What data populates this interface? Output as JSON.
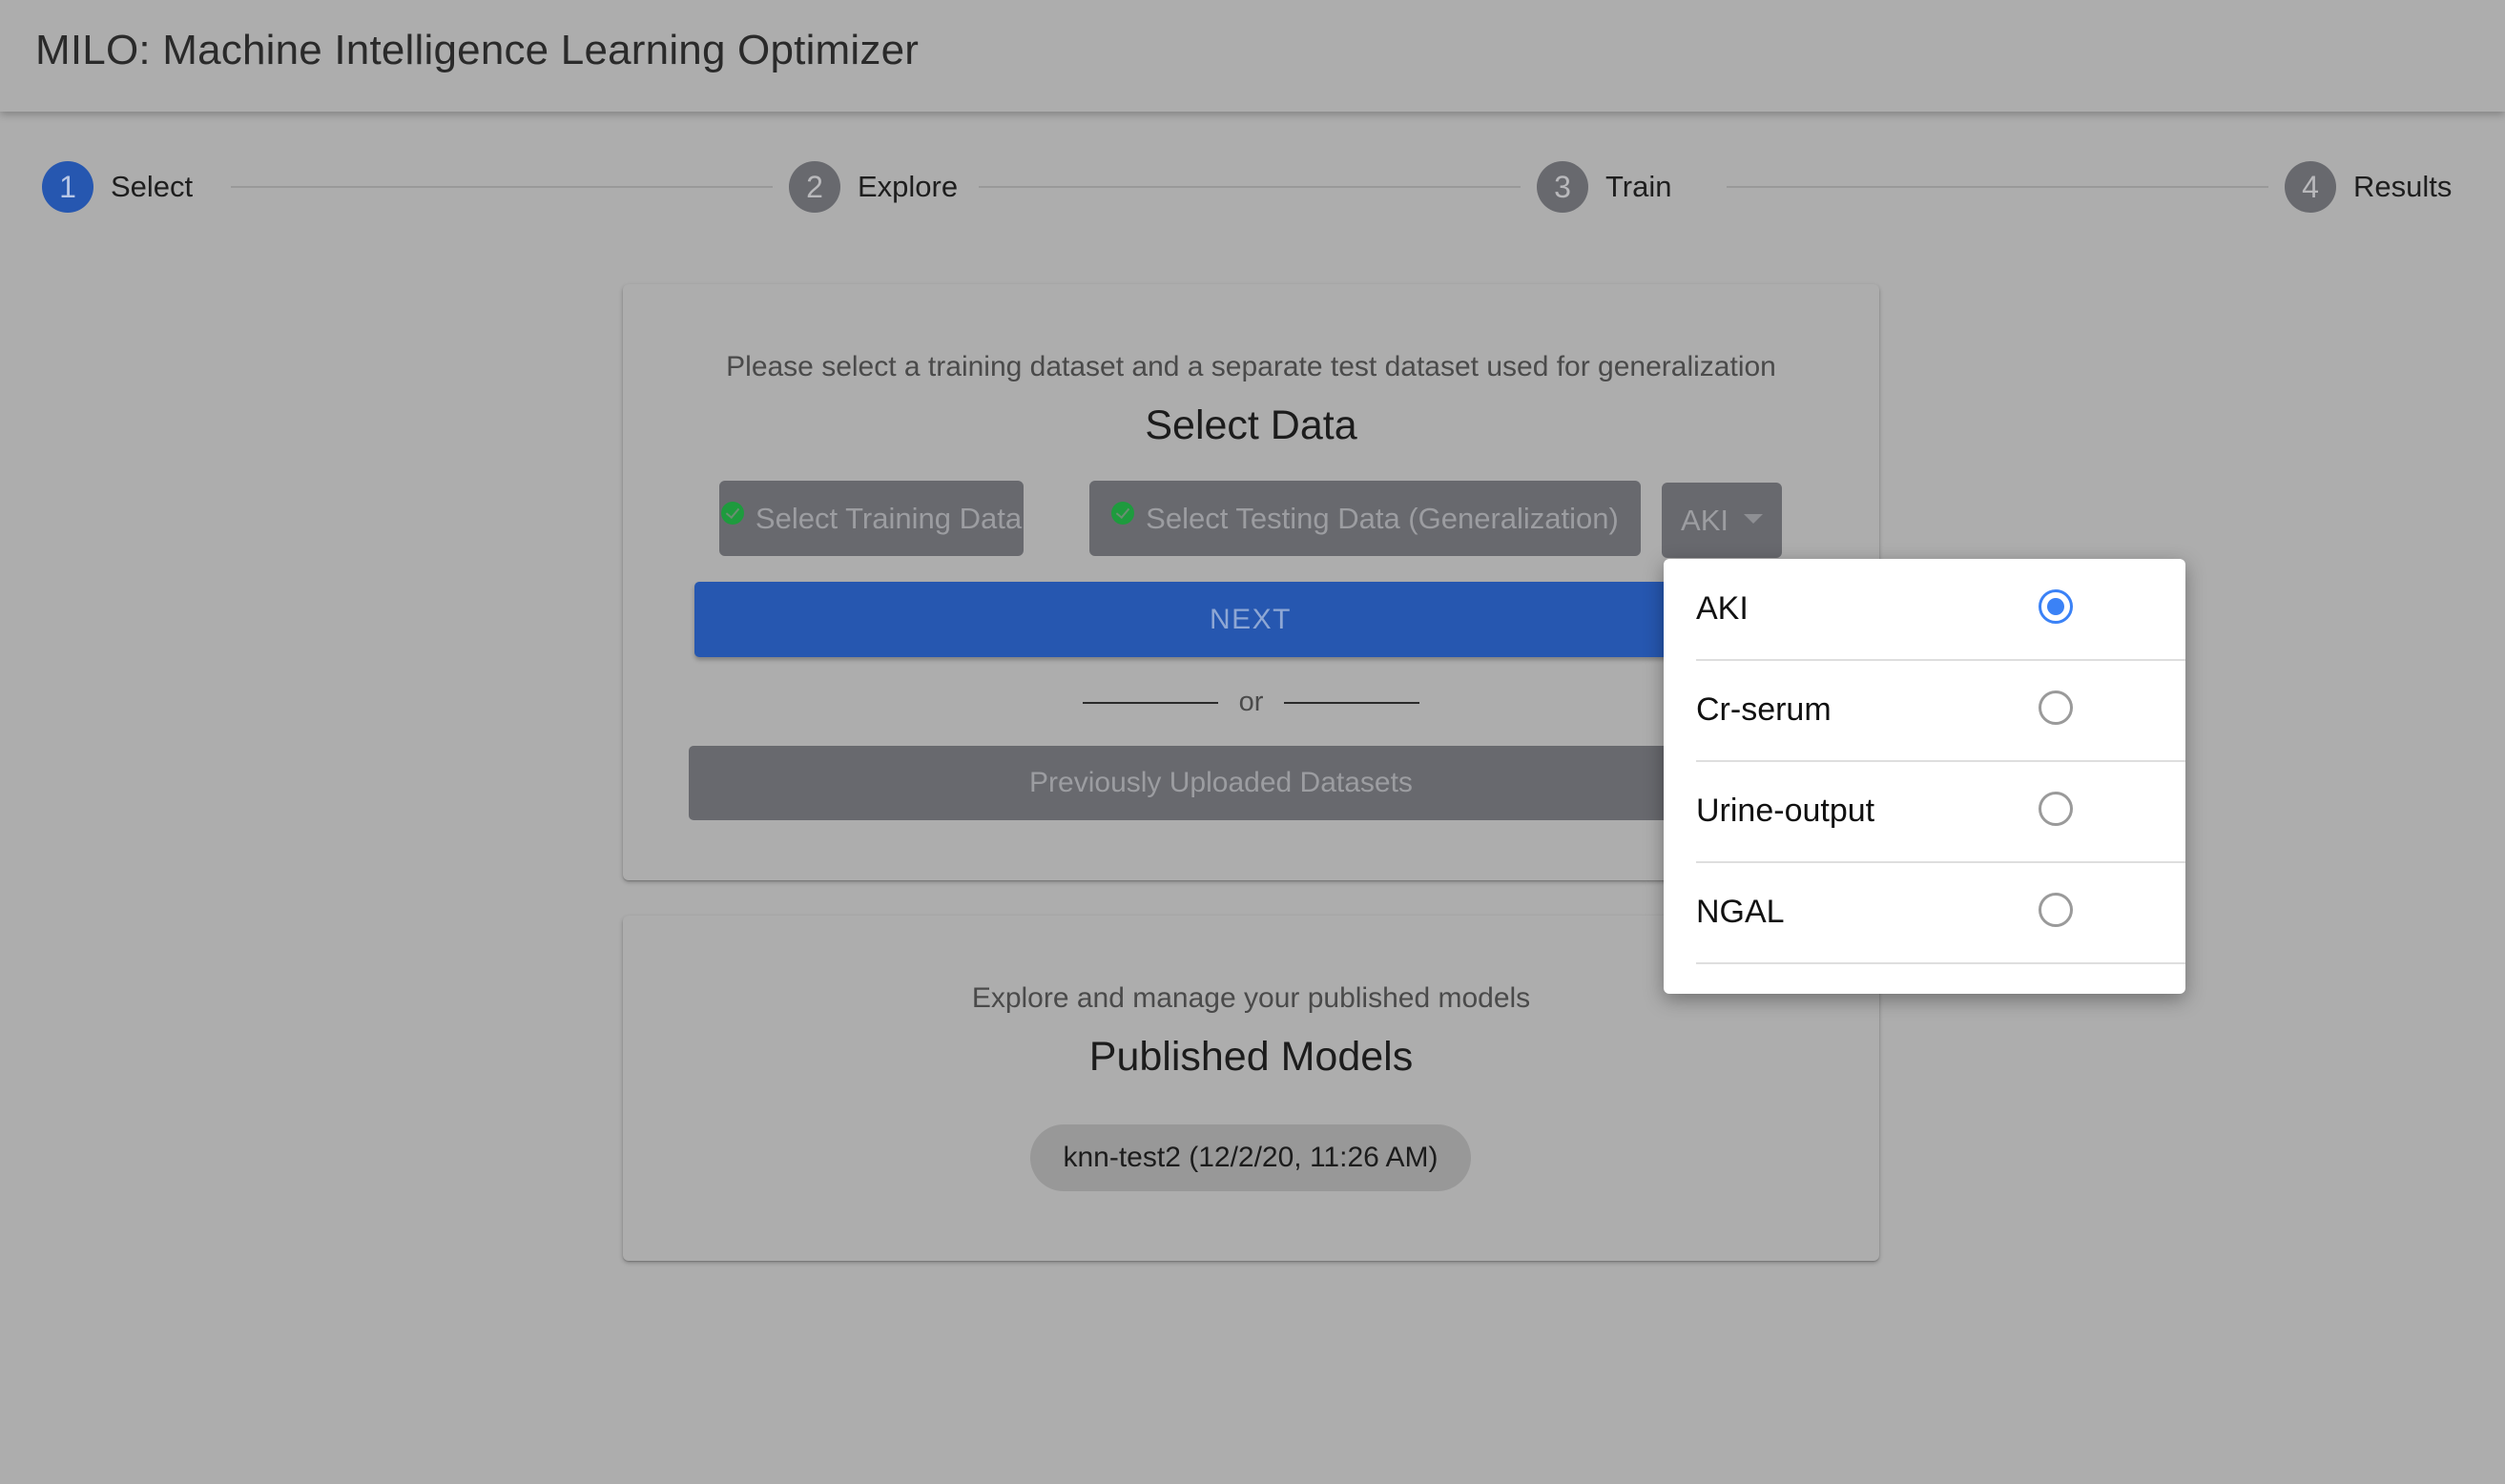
{
  "app": {
    "title": "MILO: Machine Intelligence Learning Optimizer"
  },
  "stepper": {
    "active_step": 1,
    "steps": [
      {
        "number": "1",
        "label": "Select"
      },
      {
        "number": "2",
        "label": "Explore"
      },
      {
        "number": "3",
        "label": "Train"
      },
      {
        "number": "4",
        "label": "Results"
      }
    ]
  },
  "select_card": {
    "subtitle": "Please select a training dataset and a separate test dataset used for generalization",
    "heading": "Select Data",
    "training_button": {
      "label": "Select Training Data",
      "status_icon": "check-circle-icon",
      "status": "selected"
    },
    "testing_button": {
      "label": "Select Testing Data (Generalization)",
      "status_icon": "check-circle-icon",
      "status": "selected"
    },
    "target_select": {
      "value": "AKI",
      "icon": "caret-down-icon"
    },
    "next_label": "NEXT",
    "divider_text": "or",
    "previous_label": "Previously Uploaded Datasets"
  },
  "published_card": {
    "subtitle": "Explore and manage your published models",
    "heading": "Published Models",
    "models": [
      {
        "label": "knn-test2 (12/2/20, 11:26 AM)"
      }
    ]
  },
  "target_menu": {
    "selected": "AKI",
    "options": [
      {
        "label": "AKI",
        "checked": true
      },
      {
        "label": "Cr-serum",
        "checked": false
      },
      {
        "label": "Urine-output",
        "checked": false
      },
      {
        "label": "NGAL",
        "checked": false
      }
    ]
  },
  "colors": {
    "primary": "#2657b0",
    "radio_selected": "#3b82f6",
    "check_green": "#1e9b3e",
    "overlay_background": "#adadad"
  }
}
